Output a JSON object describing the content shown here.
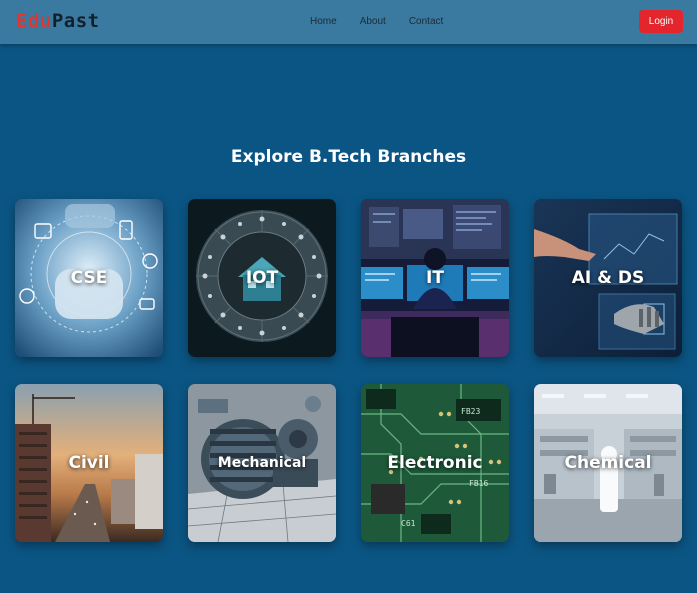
{
  "logo": {
    "part1": "Edu",
    "part2": "Past"
  },
  "nav": {
    "links": [
      "Home",
      "About",
      "Contact"
    ],
    "login": "Login"
  },
  "section": {
    "title": "Explore B.Tech Branches"
  },
  "branches": [
    {
      "label": "CSE",
      "icon": "computer-hand-image"
    },
    {
      "label": "IOT",
      "icon": "smart-home-image"
    },
    {
      "label": "IT",
      "icon": "programmer-screens-image"
    },
    {
      "label": "AI & DS",
      "icon": "robot-hand-image"
    },
    {
      "label": "Civil",
      "icon": "construction-sunset-image"
    },
    {
      "label": "Mechanical",
      "icon": "engine-machine-image"
    },
    {
      "label": "Electronic",
      "icon": "circuit-board-image"
    },
    {
      "label": "Chemical",
      "icon": "lab-equipment-image"
    }
  ]
}
